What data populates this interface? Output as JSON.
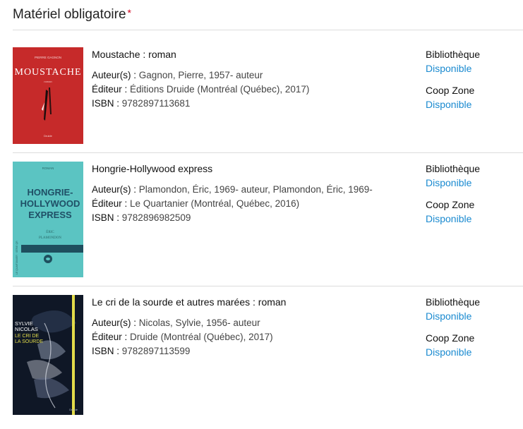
{
  "section": {
    "title": "Matériel obligatoire",
    "required_mark": "*"
  },
  "labels": {
    "author": "Auteur(s) :",
    "publisher": "Éditeur :",
    "isbn": "ISBN :"
  },
  "books": [
    {
      "title": "Moustache : roman",
      "author": "Gagnon, Pierre, 1957- auteur",
      "publisher": "Éditions Druide (Montréal (Québec), 2017)",
      "isbn": "9782897113681",
      "cover": {
        "top_text": "PIERRE GAGNON",
        "main_text": "MOUSTACHE",
        "sub_text": "roman",
        "footer": "Druide"
      },
      "availability": [
        {
          "location": "Bibliothèque",
          "status": "Disponible"
        },
        {
          "location": "Coop Zone",
          "status": "Disponible"
        }
      ]
    },
    {
      "title": "Hongrie-Hollywood express",
      "author": "Plamondon, Éric, 1969- auteur, Plamondon, Éric, 1969-",
      "publisher": "Le Quartanier (Montréal, Québec, 2016)",
      "isbn": "9782896982509",
      "cover": {
        "top_text": "ROMAN",
        "main_lines": [
          "HONGRIE-",
          "HOLLYWOOD",
          "EXPRESS"
        ],
        "author_lines": [
          "ÉRIC",
          "PLAMONDON"
        ],
        "spine": "LE QUARTANIER · SÉRIE QR"
      },
      "availability": [
        {
          "location": "Bibliothèque",
          "status": "Disponible"
        },
        {
          "location": "Coop Zone",
          "status": "Disponible"
        }
      ]
    },
    {
      "title": "Le cri de la sourde et autres marées : roman",
      "author": "Nicolas, Sylvie, 1956- auteur",
      "publisher": "Druide (Montréal (Québec), 2017)",
      "isbn": "9782897113599",
      "cover": {
        "author_lines": [
          "SYLVIE",
          "NICOLAS"
        ],
        "title_lines": [
          "LE CRI DE",
          "LA SOURDE"
        ],
        "footer": "Druide"
      },
      "availability": [
        {
          "location": "Bibliothèque",
          "status": "Disponible"
        },
        {
          "location": "Coop Zone",
          "status": "Disponible"
        }
      ]
    }
  ],
  "colors": {
    "accent": "#1a8ad0",
    "required": "#d0021b",
    "cover1": "#c62a2a",
    "cover2": "#5bc4c2",
    "cover3": "#0f1726"
  }
}
